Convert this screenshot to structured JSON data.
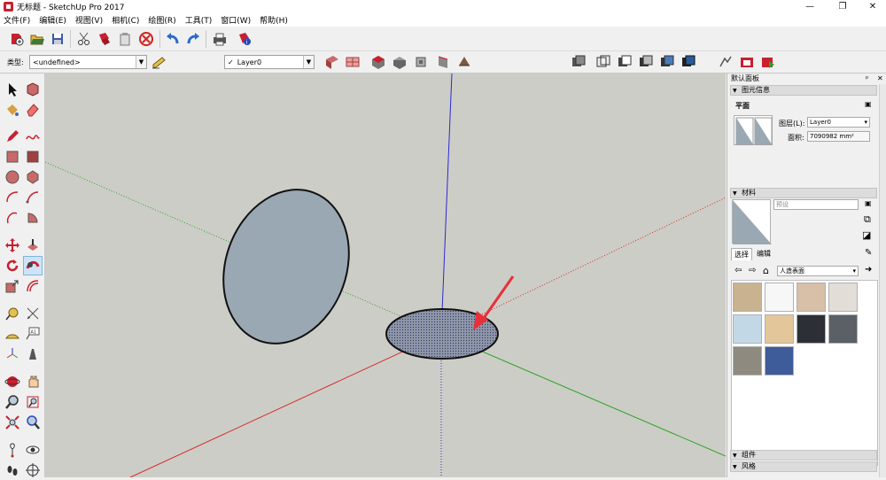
{
  "window": {
    "title": "无标题 - SketchUp Pro 2017",
    "controls": [
      "—",
      "❐",
      "✕"
    ]
  },
  "menu": [
    "文件(F)",
    "编辑(E)",
    "视图(V)",
    "相机(C)",
    "绘图(R)",
    "工具(T)",
    "窗口(W)",
    "帮助(H)"
  ],
  "toolbar": {
    "type_label": "类型:",
    "type_value": "<undefined>",
    "layer_check": "✓",
    "layer_value": "Layer0"
  },
  "panel": {
    "title": "默认面板",
    "pin": "ᵖ",
    "close": "✕",
    "entity_info": {
      "header": "图元信息",
      "entity_type": "平面",
      "layer_label": "图层(L):",
      "layer_value": "Layer0",
      "area_label": "面积:",
      "area_value": "7090982 mm²"
    },
    "materials": {
      "header": "材料",
      "name_placeholder": "预设",
      "tab_select": "选择",
      "tab_edit": "编辑",
      "collection": "人造表面",
      "swatches": [
        "#c9b28f",
        "#f7f7f7",
        "#d8bfa8",
        "#e2ddd6",
        "#c3d8e6",
        "#e3c69a",
        "#2c2f36",
        "#5a6066",
        "#8f8a80",
        "#3e5b9a"
      ]
    },
    "components_header": "组件",
    "styles_header": "风格"
  },
  "colors": {
    "viewport_bg": "#cdcdc7",
    "face_front": "#9aa8b3",
    "axis_red": "#d42a2a",
    "axis_green": "#2aa42a",
    "axis_blue": "#2a2ad4",
    "arrow": "#e8303a"
  }
}
